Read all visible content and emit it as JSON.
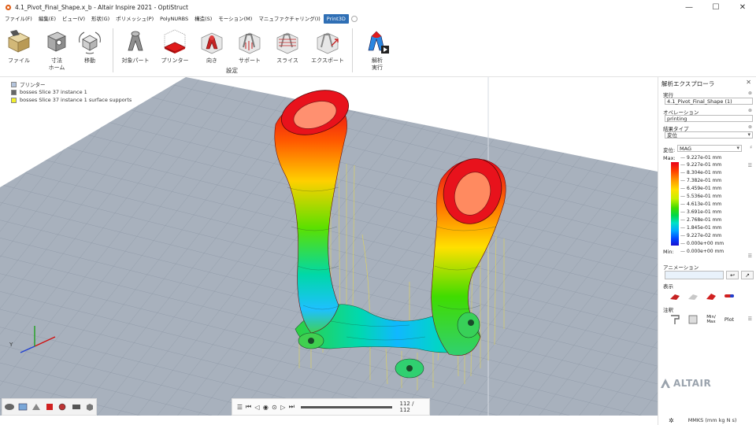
{
  "window": {
    "title": "4.1_Pivot_Final_Shape.x_b - Altair Inspire 2021 - OptiStruct",
    "minimize": "—",
    "maximize": "☐",
    "close": "✕"
  },
  "menu": [
    "ファイル(F)",
    "編集(E)",
    "ビュー(V)",
    "形状(G)",
    "ポリメッシュ(P)",
    "PolyNURBS",
    "構造(S)",
    "モーション(M)",
    "マニュファクチャリング(I)",
    "Print3D"
  ],
  "menu_active_index": 9,
  "ribbon": {
    "file": "ファイル",
    "dimension_home": [
      "寸法",
      "ホーム"
    ],
    "move": "移動",
    "target_part": "対象パート",
    "printer": "プリンター",
    "orientation": "向き",
    "support": "サポート",
    "slice": "スライス",
    "export": "エクスポート",
    "setup_group": "設定",
    "analysis_run": [
      "解析",
      "実行"
    ]
  },
  "model_tree": [
    {
      "label": "プリンター",
      "color": "#b4c4dc"
    },
    {
      "label": "bosses Slice 37  instance 1",
      "color": "#666666"
    },
    {
      "label": "bosses Slice 37  instance 1 surface supports",
      "color": "#f2ef2a"
    }
  ],
  "playback": {
    "frames": "112 / 112",
    "progress": 1.0
  },
  "panel": {
    "title": "解析エクスプローラ",
    "run_label": "実行",
    "run_value": "4.1_Pivot_Final_Shape (1)",
    "operation_label": "オペレーション",
    "operation_value": "printing",
    "result_type_label": "結果タイプ",
    "result_type_value": "変位",
    "displacement_label": "変位:",
    "displacement_value": "MAG",
    "max_label": "Max:",
    "min_label": "Min:",
    "contour_values": [
      "9.227e-01  mm",
      "9.227e-01  mm",
      "8.304e-01  mm",
      "7.382e-01  mm",
      "6.459e-01  mm",
      "5.536e-01  mm",
      "4.613e-01  mm",
      "3.691e-01  mm",
      "2.768e-01  mm",
      "1.845e-01  mm",
      "9.227e-02  mm",
      "0.000e+00  mm",
      "0.000e+00  mm"
    ],
    "animation_label": "アニメーション",
    "display_label": "表示",
    "annotation_label": "注釈",
    "minmax_label": "Min/\nMax",
    "plot_label": "Plot"
  },
  "brand": "ALTAIR",
  "status": {
    "units": "MMKS (mm kg N s)"
  }
}
